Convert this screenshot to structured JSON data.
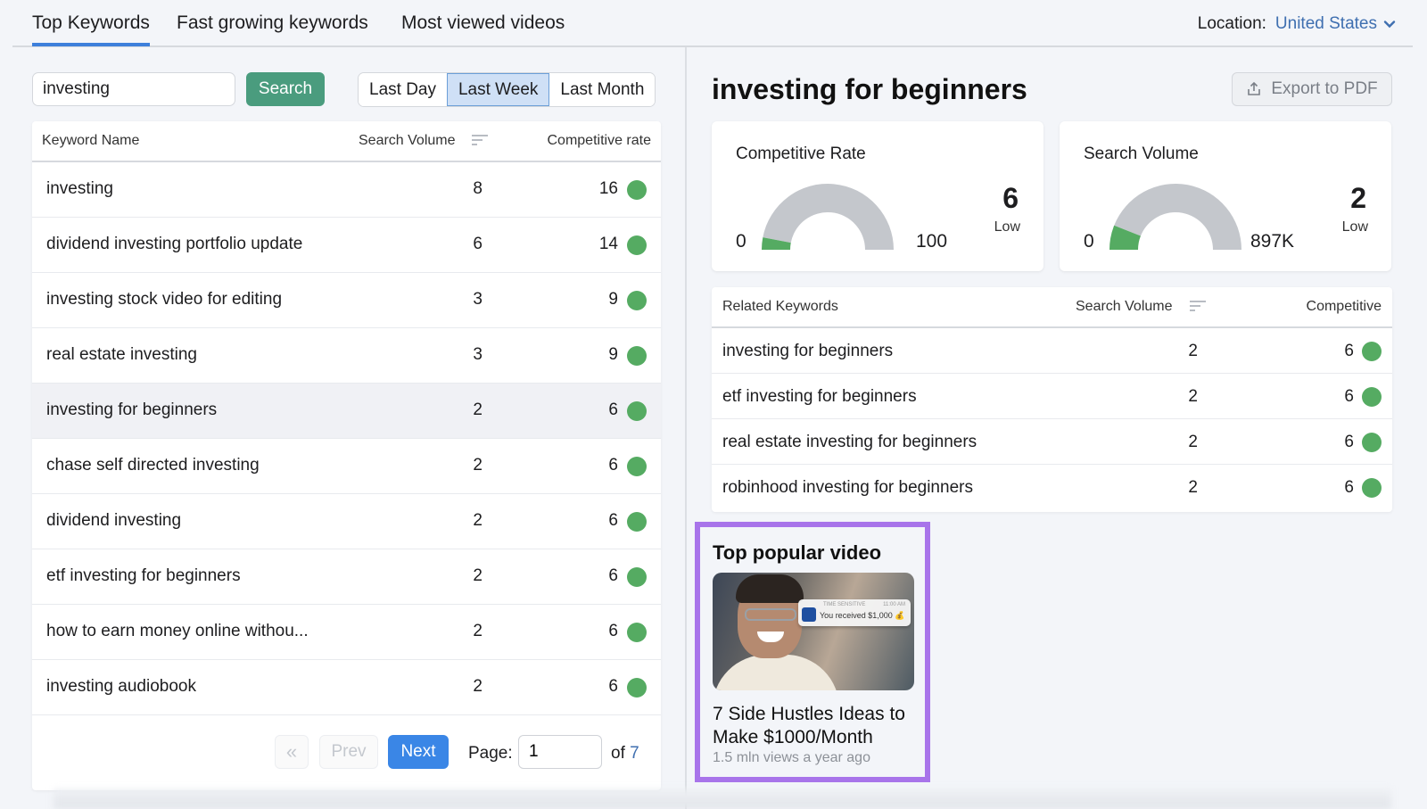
{
  "tabs": [
    {
      "label": "Top Keywords",
      "active": true
    },
    {
      "label": "Fast growing keywords",
      "active": false
    },
    {
      "label": "Most viewed videos",
      "active": false
    }
  ],
  "location": {
    "label": "Location:",
    "value": "United States",
    "icon": "chevron-down-icon"
  },
  "search": {
    "value": "investing",
    "button_label": "Search"
  },
  "time_range": {
    "options": [
      "Last Day",
      "Last Week",
      "Last Month"
    ],
    "selected": "Last Week"
  },
  "keywords_table": {
    "columns": [
      "Keyword Name",
      "Search Volume",
      "Competitive rate"
    ],
    "sort_icon": "sort-icon",
    "rows": [
      {
        "keyword": "investing",
        "volume": "8",
        "competitive": "16",
        "status_color": "#55ab62"
      },
      {
        "keyword": "dividend investing portfolio update",
        "volume": "6",
        "competitive": "14",
        "status_color": "#55ab62"
      },
      {
        "keyword": "investing stock video for editing",
        "volume": "3",
        "competitive": "9",
        "status_color": "#55ab62"
      },
      {
        "keyword": "real estate investing",
        "volume": "3",
        "competitive": "9",
        "status_color": "#55ab62"
      },
      {
        "keyword": "investing for beginners",
        "volume": "2",
        "competitive": "6",
        "status_color": "#55ab62",
        "selected": true
      },
      {
        "keyword": "chase self directed investing",
        "volume": "2",
        "competitive": "6",
        "status_color": "#55ab62"
      },
      {
        "keyword": "dividend investing",
        "volume": "2",
        "competitive": "6",
        "status_color": "#55ab62"
      },
      {
        "keyword": "etf investing for beginners",
        "volume": "2",
        "competitive": "6",
        "status_color": "#55ab62"
      },
      {
        "keyword": "how to earn money online withou...",
        "volume": "2",
        "competitive": "6",
        "status_color": "#55ab62"
      },
      {
        "keyword": "investing audiobook",
        "volume": "2",
        "competitive": "6",
        "status_color": "#55ab62"
      }
    ]
  },
  "pagination": {
    "first_label": "«",
    "prev_label": "Prev",
    "next_label": "Next",
    "page_label": "Page:",
    "current_page": "1",
    "of_label": "of",
    "total_pages": "7"
  },
  "detail": {
    "title": "investing for beginners",
    "export_label": "Export to PDF",
    "export_icon": "upload-icon",
    "competitive_rate": {
      "title": "Competitive Rate",
      "min": "0",
      "max": "100",
      "value": "6",
      "level": "Low",
      "fraction": 0.06
    },
    "search_volume": {
      "title": "Search Volume",
      "min": "0",
      "max": "897K",
      "value": "2",
      "level": "Low",
      "fraction": 0.12
    },
    "related": {
      "columns": [
        "Related Keywords",
        "Search Volume",
        "Competitive"
      ],
      "rows": [
        {
          "keyword": "investing for beginners",
          "volume": "2",
          "competitive": "6"
        },
        {
          "keyword": "etf investing for beginners",
          "volume": "2",
          "competitive": "6"
        },
        {
          "keyword": "real estate investing for beginners",
          "volume": "2",
          "competitive": "6"
        },
        {
          "keyword": "robinhood investing for beginners",
          "volume": "2",
          "competitive": "6"
        }
      ]
    },
    "top_video": {
      "heading": "Top popular video",
      "title": "7 Side Hustles Ideas to Make $1000/Month",
      "meta": "1.5 mln views a year ago",
      "thumbnail_notification": {
        "tag": "TIME SENSITIVE",
        "time": "11:00 AM",
        "text": "You received $1,000 💰"
      }
    }
  },
  "colors": {
    "accent": "#3d7fdb",
    "search_button": "#4a9c7e",
    "status_green": "#55ab62",
    "gauge_track": "#c4c7cc",
    "video_highlight": "#a874ea",
    "link": "#3f6fb0"
  }
}
